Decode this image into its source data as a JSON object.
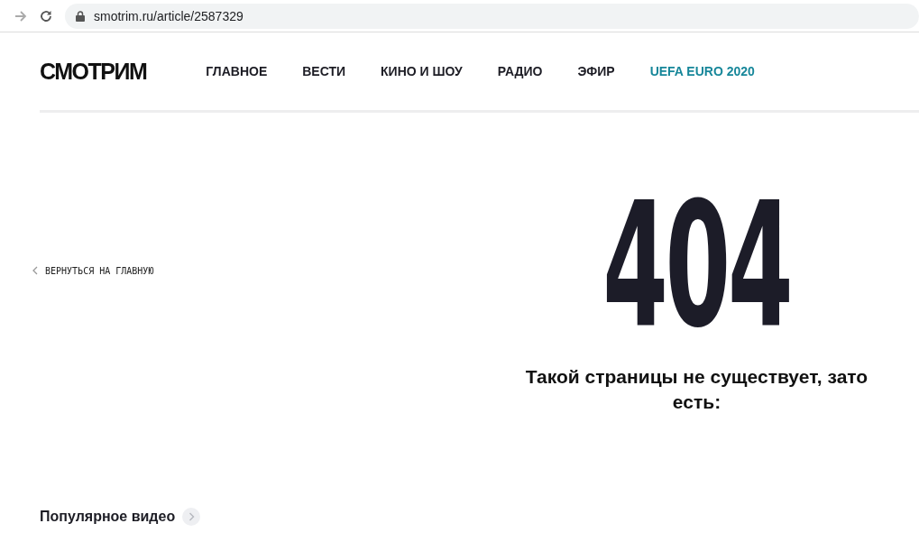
{
  "browser": {
    "url": "smotrim.ru/article/2587329"
  },
  "header": {
    "logo": "СМОТРИМ",
    "nav": [
      {
        "label": "ГЛАВНОЕ",
        "color": "#1c1c24"
      },
      {
        "label": "ВЕСТИ",
        "color": "#1c1c24"
      },
      {
        "label": "КИНО И ШОУ",
        "color": "#1c1c24"
      },
      {
        "label": "РАДИО",
        "color": "#1c1c24"
      },
      {
        "label": "ЭФИР",
        "color": "#1c1c24"
      },
      {
        "label": "UEFA EURO 2020",
        "color": "#17879a"
      }
    ]
  },
  "back_link": "ВЕРНУТЬСЯ НА ГЛАВНУЮ",
  "error": {
    "code": "404",
    "message": "Такой страницы не существует, зато есть:"
  },
  "popular": {
    "title": "Популярное видео"
  }
}
